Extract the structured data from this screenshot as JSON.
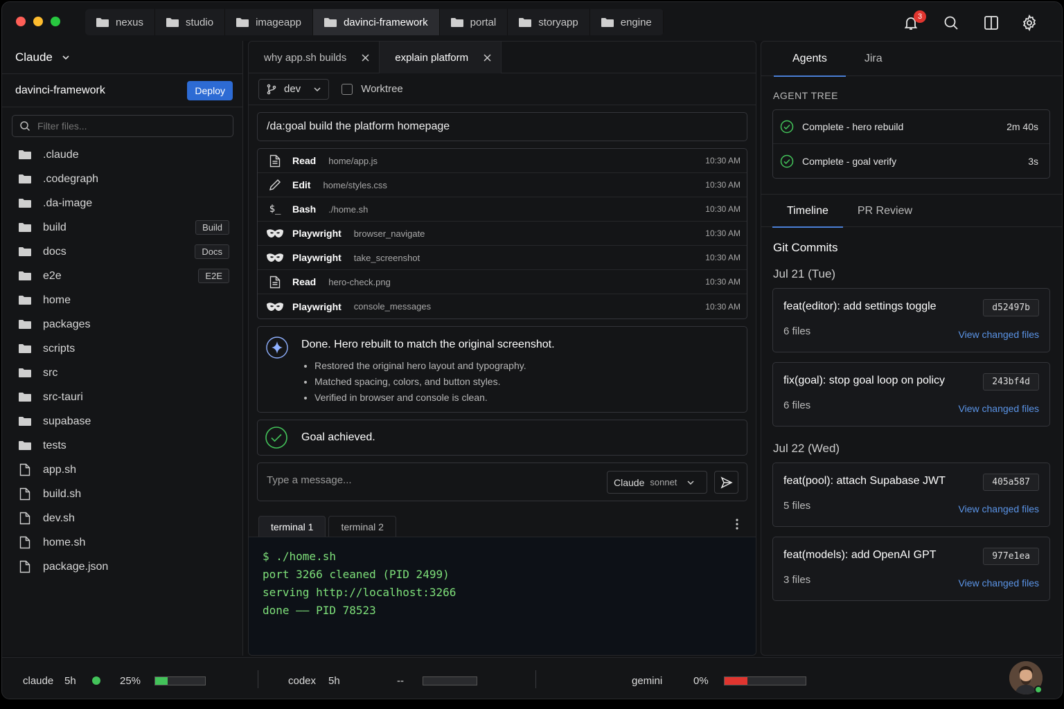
{
  "top_tabs": [
    {
      "label": "nexus",
      "active": false
    },
    {
      "label": "studio",
      "active": false
    },
    {
      "label": "imageapp",
      "active": false
    },
    {
      "label": "davinci-framework",
      "active": true
    },
    {
      "label": "portal",
      "active": false
    },
    {
      "label": "storyapp",
      "active": false
    },
    {
      "label": "engine",
      "active": false
    }
  ],
  "notifications": {
    "count": "3"
  },
  "sidebar": {
    "agent_selector": "Claude",
    "project_name": "davinci-framework",
    "deploy_label": "Deploy",
    "filter_placeholder": "Filter files...",
    "items": [
      {
        "name": ".claude",
        "type": "folder",
        "tag": ""
      },
      {
        "name": ".codegraph",
        "type": "folder",
        "tag": ""
      },
      {
        "name": ".da-image",
        "type": "folder",
        "tag": ""
      },
      {
        "name": "build",
        "type": "folder",
        "tag": "Build"
      },
      {
        "name": "docs",
        "type": "folder",
        "tag": "Docs"
      },
      {
        "name": "e2e",
        "type": "folder",
        "tag": "E2E"
      },
      {
        "name": "home",
        "type": "folder",
        "tag": ""
      },
      {
        "name": "packages",
        "type": "folder",
        "tag": ""
      },
      {
        "name": "scripts",
        "type": "folder",
        "tag": ""
      },
      {
        "name": "src",
        "type": "folder",
        "tag": ""
      },
      {
        "name": "src-tauri",
        "type": "folder",
        "tag": ""
      },
      {
        "name": "supabase",
        "type": "folder",
        "tag": ""
      },
      {
        "name": "tests",
        "type": "folder",
        "tag": ""
      },
      {
        "name": "app.sh",
        "type": "file",
        "tag": ""
      },
      {
        "name": "build.sh",
        "type": "file",
        "tag": ""
      },
      {
        "name": "dev.sh",
        "type": "file",
        "tag": ""
      },
      {
        "name": "home.sh",
        "type": "file",
        "tag": ""
      },
      {
        "name": "package.json",
        "type": "file",
        "tag": ""
      }
    ]
  },
  "center": {
    "tabs": [
      {
        "label": "why app.sh builds",
        "active": false
      },
      {
        "label": "explain platform",
        "active": true
      }
    ],
    "branch": "dev",
    "worktree_label": "Worktree",
    "goal": "/da:goal build the platform homepage",
    "steps": [
      {
        "tool": "Read",
        "icon": "file-icon",
        "arg": "home/app.js",
        "time": "10:30 AM"
      },
      {
        "tool": "Edit",
        "icon": "pencil-icon",
        "arg": "home/styles.css",
        "time": "10:30 AM"
      },
      {
        "tool": "Bash",
        "icon": "terminal-icon",
        "arg": "./home.sh",
        "time": "10:30 AM"
      },
      {
        "tool": "Playwright",
        "icon": "mask-icon",
        "arg": "browser_navigate",
        "time": "10:30 AM"
      },
      {
        "tool": "Playwright",
        "icon": "mask-icon",
        "arg": "take_screenshot",
        "time": "10:30 AM"
      },
      {
        "tool": "Read",
        "icon": "file-icon",
        "arg": "hero-check.png",
        "time": "10:30 AM"
      },
      {
        "tool": "Playwright",
        "icon": "mask-icon",
        "arg": "console_messages",
        "time": "10:30 AM"
      }
    ],
    "result": {
      "title": "Done. Hero rebuilt to match the original screenshot.",
      "bullets": [
        "Restored the original hero layout and typography.",
        "Matched spacing, colors, and button styles.",
        "Verified in browser and console is clean."
      ]
    },
    "achieved": "Goal achieved.",
    "message_placeholder": "Type a message...",
    "model_name": "Claude",
    "model_variant": "sonnet",
    "terminal_tabs": [
      {
        "label": "terminal 1",
        "active": true
      },
      {
        "label": "terminal 2",
        "active": false
      }
    ],
    "terminal_lines": [
      "$ ./home.sh",
      "port 3266 cleaned (PID 2499)",
      "serving http://localhost:3266",
      "done —— PID 78523"
    ]
  },
  "right": {
    "tabs": [
      {
        "label": "Agents",
        "active": true
      },
      {
        "label": "Jira",
        "active": false
      }
    ],
    "agent_tree_title": "AGENT TREE",
    "agents": [
      {
        "label": "Complete - hero rebuild",
        "duration": "2m 40s"
      },
      {
        "label": "Complete - goal verify",
        "duration": "3s"
      }
    ],
    "tabs2": [
      {
        "label": "Timeline",
        "active": true
      },
      {
        "label": "PR Review",
        "active": false
      }
    ],
    "git_title": "Git Commits",
    "groups": [
      {
        "date": "Jul 21 (Tue)",
        "commits": [
          {
            "message": "feat(editor): add settings toggle",
            "files": "6 files",
            "hash": "d52497b",
            "view": "View changed files"
          },
          {
            "message": "fix(goal): stop goal loop on policy",
            "files": "6 files",
            "hash": "243bf4d",
            "view": "View changed files"
          }
        ]
      },
      {
        "date": "Jul 22 (Wed)",
        "commits": [
          {
            "message": "feat(pool): attach Supabase JWT",
            "files": "5 files",
            "hash": "405a587",
            "view": "View changed files"
          },
          {
            "message": "feat(models): add OpenAI GPT",
            "files": "3 files",
            "hash": "977e1ea",
            "view": "View changed files"
          }
        ]
      }
    ]
  },
  "status": {
    "claude": {
      "name": "claude",
      "window": "5h",
      "percent": "25%",
      "usage": 0.25,
      "color": "#43c35a"
    },
    "codex": {
      "name": "codex",
      "window": "5h",
      "percent": "--",
      "usage": 0
    },
    "gemini": {
      "name": "gemini",
      "percent": "0%",
      "usage": 0.28,
      "color": "#e0352f"
    }
  },
  "colors": {
    "accent": "#2d6bd4",
    "success": "#43c35a",
    "danger": "#e0352f",
    "link": "#5b95e8"
  }
}
